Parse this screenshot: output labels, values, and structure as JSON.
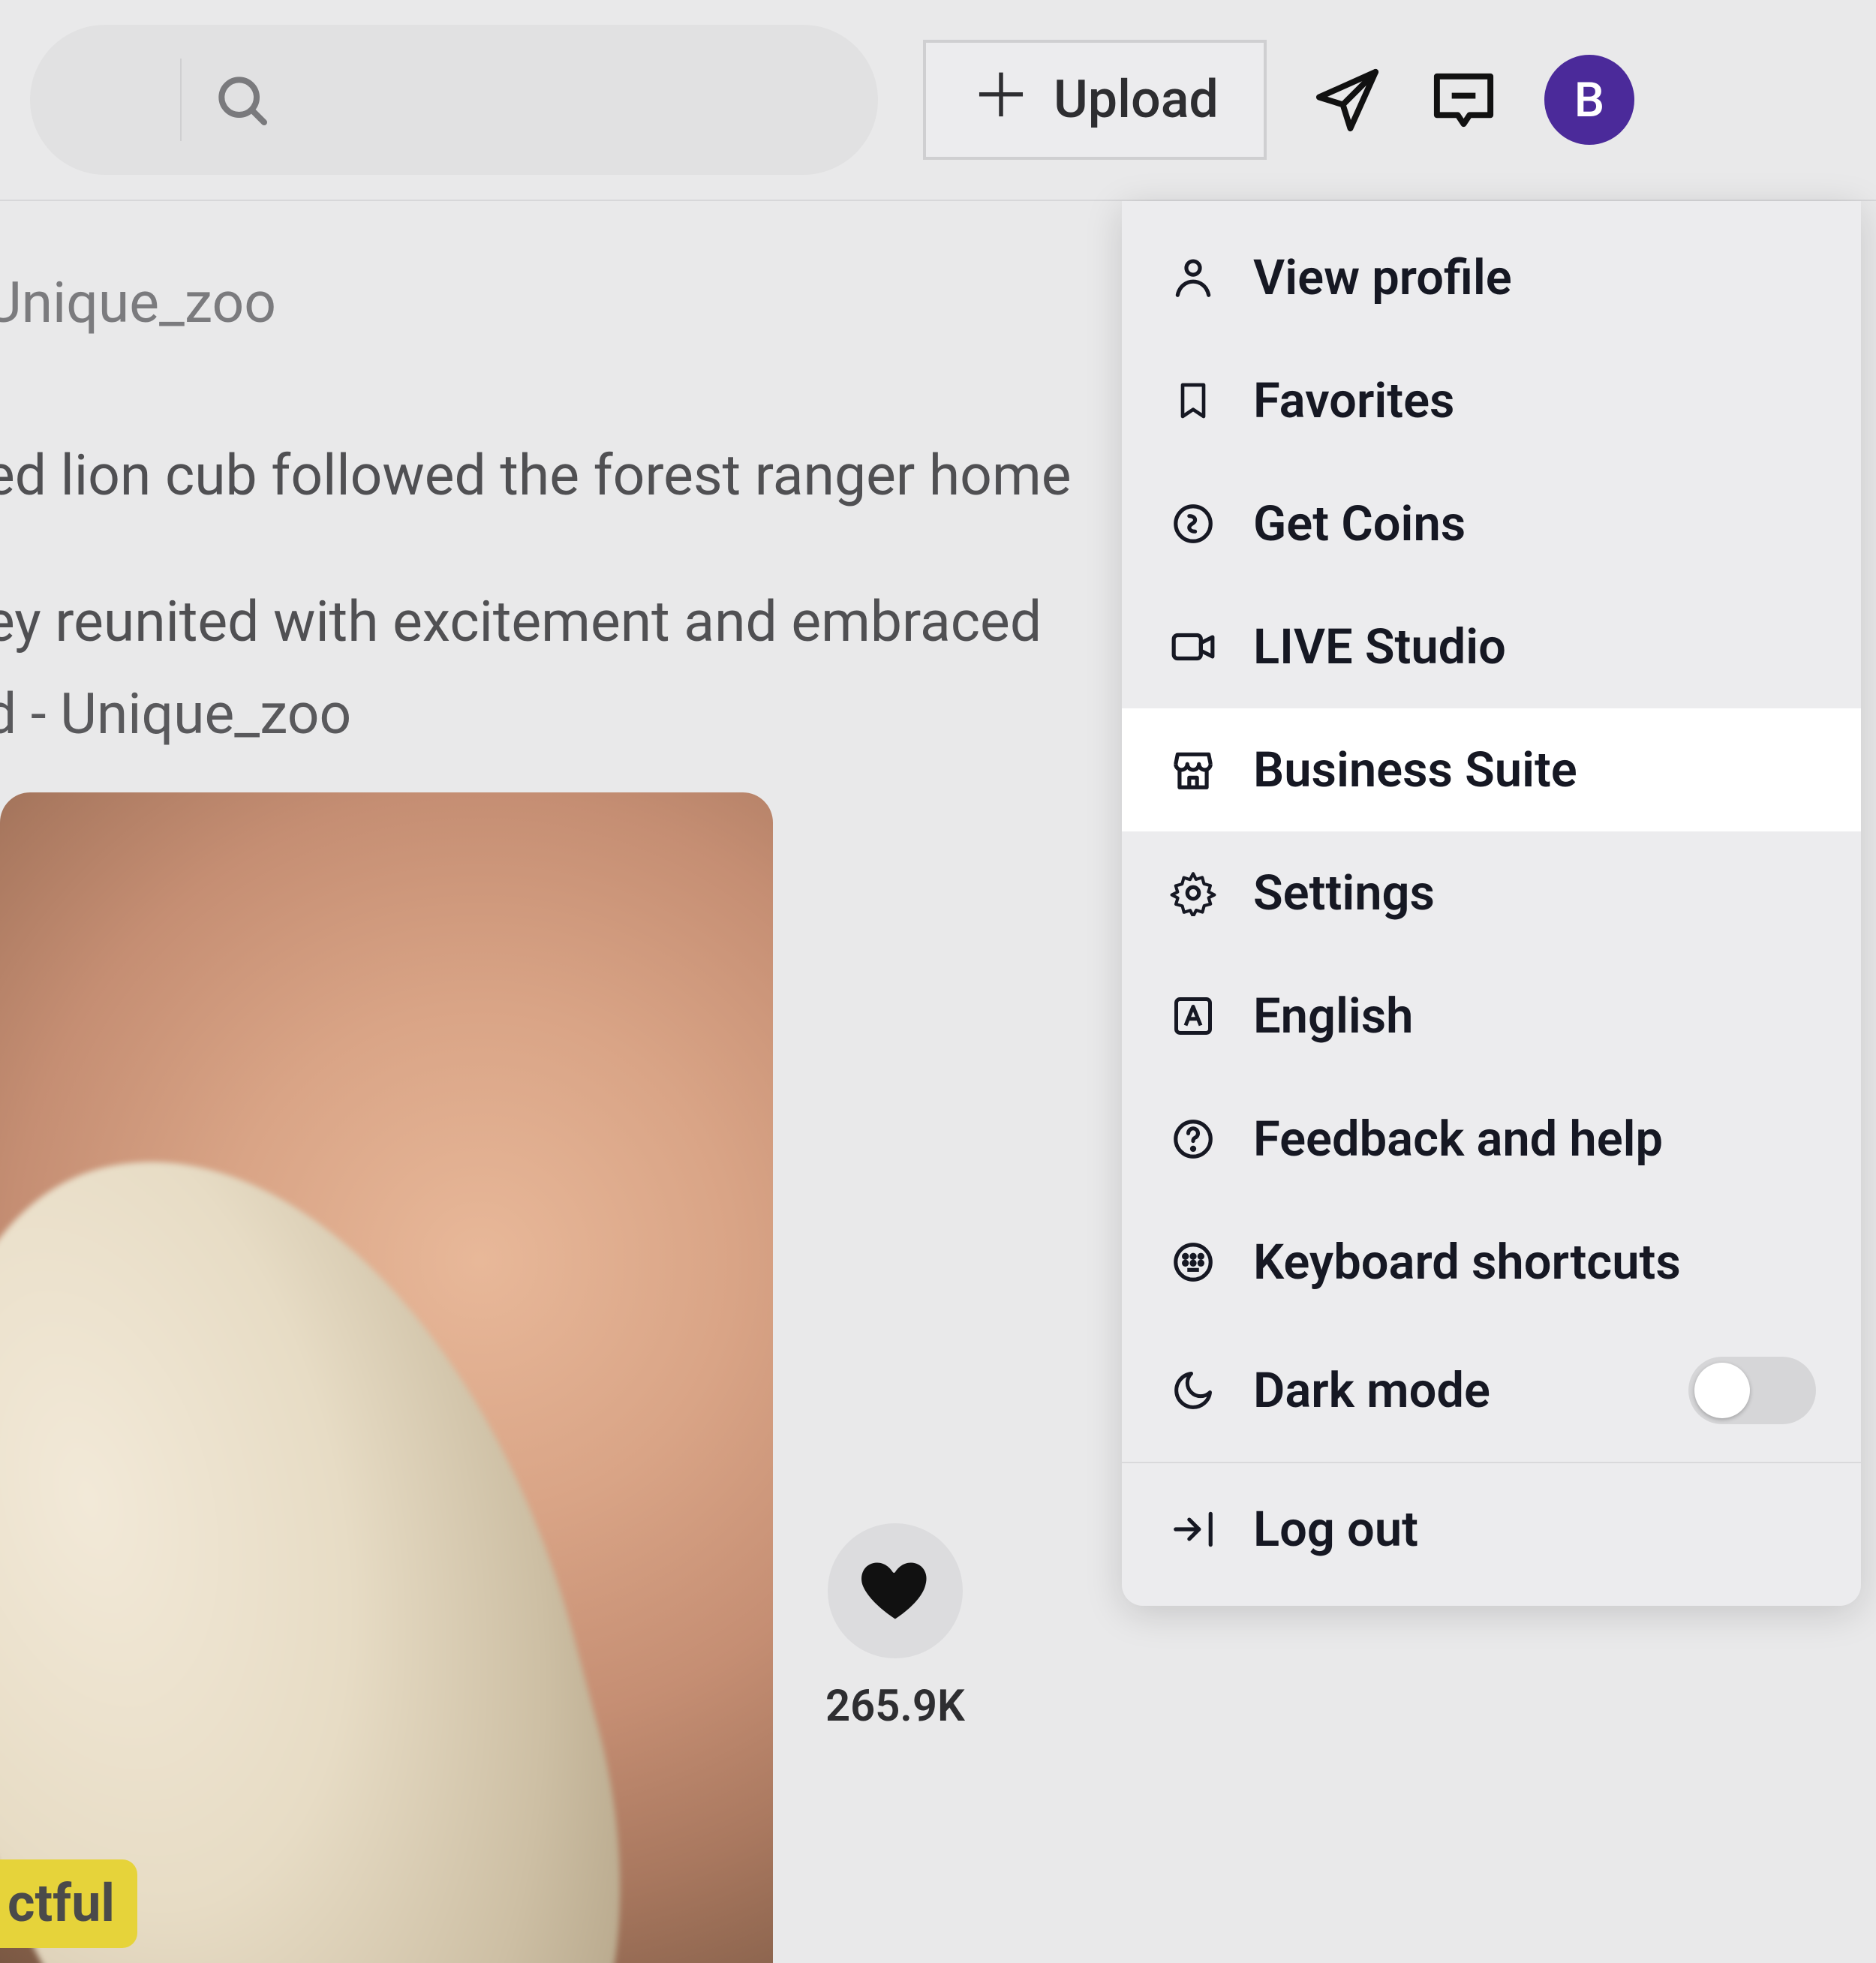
{
  "header": {
    "upload_label": "Upload",
    "avatar_letter": "B"
  },
  "content": {
    "username": "Unique_zoo",
    "caption_line1": "ed lion cub followed the forest ranger home",
    "caption_line2": "ey reunited with excitement and embraced",
    "sound": "d - Unique_zoo",
    "badge": "ctful",
    "like_count": "265.9K"
  },
  "menu": {
    "items": [
      {
        "id": "view-profile",
        "label": "View profile",
        "icon": "person-icon"
      },
      {
        "id": "favorites",
        "label": "Favorites",
        "icon": "bookmark-icon"
      },
      {
        "id": "get-coins",
        "label": "Get Coins",
        "icon": "coin-icon"
      },
      {
        "id": "live-studio",
        "label": "LIVE Studio",
        "icon": "camera-icon"
      },
      {
        "id": "business-suite",
        "label": "Business Suite",
        "icon": "store-icon",
        "highlight": true
      },
      {
        "id": "settings",
        "label": "Settings",
        "icon": "gear-icon"
      },
      {
        "id": "language",
        "label": "English",
        "icon": "language-icon"
      },
      {
        "id": "feedback",
        "label": "Feedback and help",
        "icon": "help-icon"
      },
      {
        "id": "shortcuts",
        "label": "Keyboard shortcuts",
        "icon": "keyboard-icon"
      },
      {
        "id": "dark-mode",
        "label": "Dark mode",
        "icon": "moon-icon",
        "toggle": false
      }
    ],
    "logout_label": "Log out"
  }
}
